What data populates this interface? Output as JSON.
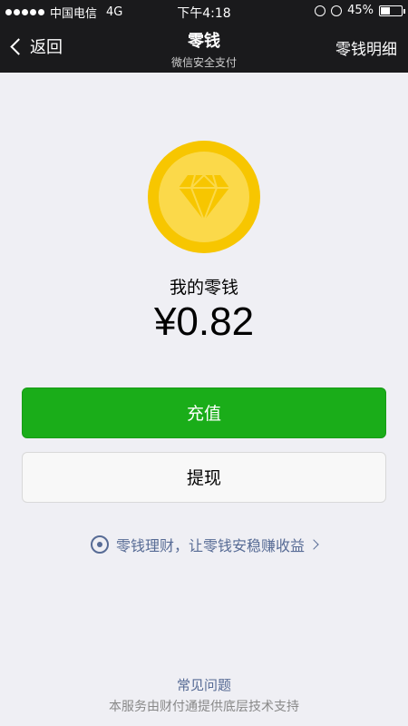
{
  "status_bar": {
    "carrier": "中国电信",
    "network": "4G",
    "time": "下午4:18",
    "battery": "45%",
    "battery_level": 0.45
  },
  "nav": {
    "back_label": "返回",
    "title": "零钱",
    "subtitle": "微信安全支付",
    "right_label": "零钱明细"
  },
  "wallet": {
    "balance_label": "我的零钱",
    "balance_amount": "¥0.82",
    "coin_color": "#f7c600"
  },
  "actions": {
    "recharge_label": "充值",
    "withdraw_label": "提现",
    "recharge_color": "#1aad19"
  },
  "promo": {
    "text": "零钱理财，让零钱安稳赚收益"
  },
  "footer": {
    "faq_label": "常见问题",
    "note": "本服务由财付通提供底层技术支持"
  },
  "icons": [
    "signal-icon",
    "alarm-icon",
    "lock-rotation-icon",
    "battery-icon",
    "back-chevron-icon",
    "diamond-icon",
    "wealth-icon",
    "chevron-right-icon"
  ]
}
